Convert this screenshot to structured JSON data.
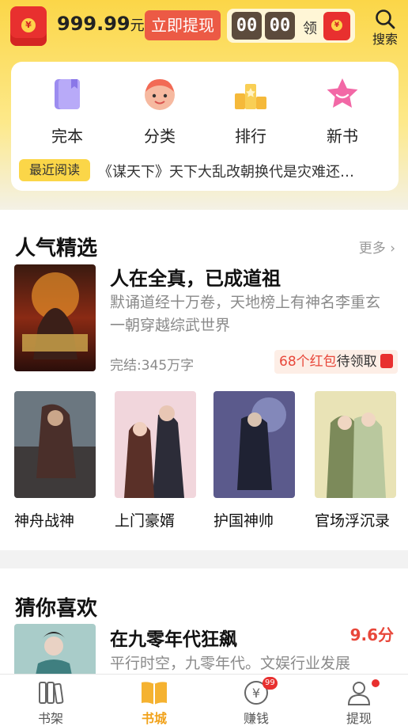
{
  "topbar": {
    "balance_amount": "999.99",
    "balance_unit": "元",
    "withdraw_label": "立即提现",
    "timer_minutes": "00",
    "timer_seconds": "00",
    "claim_label": "领",
    "search_label": "搜索",
    "redpack_symbol": "¥"
  },
  "nav": {
    "items": [
      {
        "label": "完本",
        "icon": "book-complete-icon"
      },
      {
        "label": "分类",
        "icon": "category-face-icon"
      },
      {
        "label": "排行",
        "icon": "ranking-podium-icon"
      },
      {
        "label": "新书",
        "icon": "new-book-star-icon"
      }
    ],
    "recent_tag": "最近阅读",
    "recent_text": "《谋天下》天下大乱改朝换代是灾难还…"
  },
  "popular": {
    "title": "人气精选",
    "more_label": "更多",
    "featured": {
      "title": "人在全真，已成道祖",
      "description": "默诵道经十万卷，天地榜上有神名李重玄一朝穿越综武世界",
      "status": "完结:345万字",
      "bonus_count": "68个红包",
      "bonus_text": "待领取"
    },
    "books": [
      {
        "name": "神舟战神"
      },
      {
        "name": "上门豪婿"
      },
      {
        "name": "护国神帅"
      },
      {
        "name": "官场浮沉录"
      }
    ]
  },
  "guess": {
    "title": "猜你喜欢",
    "book": {
      "title": "在九零年代狂飙",
      "score": "9.6分",
      "description": "平行时空，九零年代。文娱行业发展"
    }
  },
  "tabbar": {
    "tabs": [
      {
        "label": "书架",
        "icon": "bookshelf-icon"
      },
      {
        "label": "书城",
        "icon": "book-store-icon"
      },
      {
        "label": "赚钱",
        "icon": "yen-coin-icon",
        "badge": "99"
      },
      {
        "label": "提现",
        "icon": "user-icon"
      }
    ],
    "active_color": "#f1a21b"
  },
  "colors": {
    "brand_yellow": "#fbd648",
    "accent_red": "#e8473a"
  }
}
